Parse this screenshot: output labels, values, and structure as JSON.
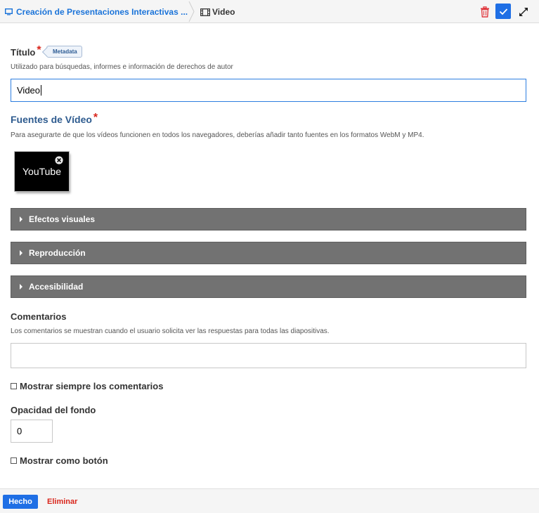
{
  "breadcrumb": {
    "parent": "Creación de Presentaciones Interactivas ...",
    "current": "Video",
    "parent_icon": "monitor-icon",
    "current_icon": "film-icon"
  },
  "toolbar": {
    "delete_icon": "trash-icon",
    "confirm_icon": "check-icon",
    "expand_icon": "expand-icon"
  },
  "title_field": {
    "label": "Título",
    "required_mark": "*",
    "metadata_label": "Metadata",
    "description": "Utilizado para búsquedas, informes e información de derechos de autor",
    "value": "Video"
  },
  "sources": {
    "label": "Fuentes de Vídeo",
    "required_mark": "*",
    "description": "Para asegurarte de que los vídeos funcionen en todos los navegadores, deberías añadir tanto fuentes en los formatos WebM y MP4.",
    "item_label": "YouTube"
  },
  "groups": [
    {
      "label": "Efectos visuales"
    },
    {
      "label": "Reproducción"
    },
    {
      "label": "Accesibilidad"
    }
  ],
  "comments": {
    "label": "Comentarios",
    "description": "Los comentarios se muestran cuando el usuario solicita ver las respuestas para todas las diapositivas.",
    "value": ""
  },
  "always_show_comments": {
    "label": "Mostrar siempre los comentarios",
    "checked": false
  },
  "background_opacity": {
    "label": "Opacidad del fondo",
    "value": "0"
  },
  "show_as_button": {
    "label": "Mostrar como botón",
    "checked": false
  },
  "footer": {
    "done_label": "Hecho",
    "delete_label": "Eliminar"
  },
  "colors": {
    "accent": "#1f6fe5",
    "danger": "#d9261c",
    "group_header": "#727272",
    "section_title": "#2e5b8f"
  }
}
